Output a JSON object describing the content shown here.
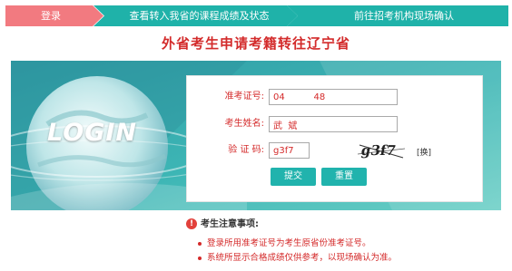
{
  "steps": [
    {
      "label": "登录",
      "active": true
    },
    {
      "label": "查看转入我省的课程成绩及状态",
      "active": false
    },
    {
      "label": "前往招考机构现场确认",
      "active": false
    }
  ],
  "colors": {
    "active_step": "#f27a80",
    "step": "#1fb2a9",
    "title": "#d32b2b",
    "button": "#21b3ad"
  },
  "page_title": "外省考生申请考籍转往辽宁省",
  "banner": {
    "logo_text": "LOGIN"
  },
  "form": {
    "exam_id_label": "准考证号:",
    "exam_id_value": "04          48",
    "name_label": "考生姓名:",
    "name_value": "武  斌",
    "captcha_label": "验 证 码:",
    "captcha_value": "g3f7",
    "captcha_image_text": "g3f7",
    "refresh_label": "[换]",
    "submit_label": "提交",
    "reset_label": "重置"
  },
  "notice": {
    "title": "考生注意事项:",
    "items": [
      "登录所用准考证号为考生原省份准考证号。",
      "系统所显示合格成绩仅供参考，以现场确认为准。"
    ]
  }
}
